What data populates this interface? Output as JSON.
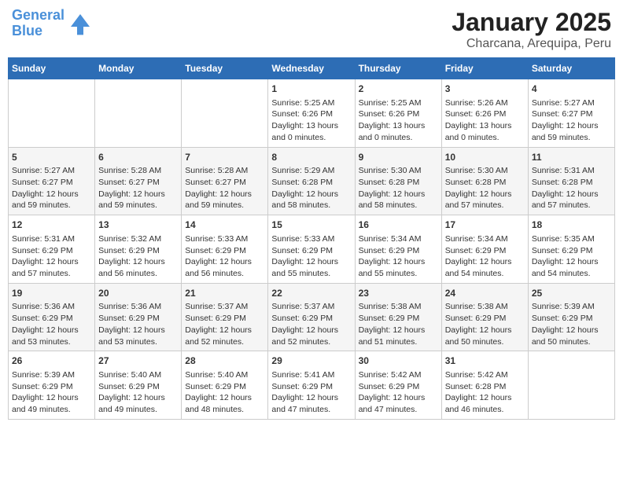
{
  "header": {
    "logo_line1": "General",
    "logo_line2": "Blue",
    "title": "January 2025",
    "subtitle": "Charcana, Arequipa, Peru"
  },
  "days_of_week": [
    "Sunday",
    "Monday",
    "Tuesday",
    "Wednesday",
    "Thursday",
    "Friday",
    "Saturday"
  ],
  "weeks": [
    [
      {
        "day": "",
        "info": ""
      },
      {
        "day": "",
        "info": ""
      },
      {
        "day": "",
        "info": ""
      },
      {
        "day": "1",
        "info": "Sunrise: 5:25 AM\nSunset: 6:26 PM\nDaylight: 13 hours\nand 0 minutes."
      },
      {
        "day": "2",
        "info": "Sunrise: 5:25 AM\nSunset: 6:26 PM\nDaylight: 13 hours\nand 0 minutes."
      },
      {
        "day": "3",
        "info": "Sunrise: 5:26 AM\nSunset: 6:26 PM\nDaylight: 13 hours\nand 0 minutes."
      },
      {
        "day": "4",
        "info": "Sunrise: 5:27 AM\nSunset: 6:27 PM\nDaylight: 12 hours\nand 59 minutes."
      }
    ],
    [
      {
        "day": "5",
        "info": "Sunrise: 5:27 AM\nSunset: 6:27 PM\nDaylight: 12 hours\nand 59 minutes."
      },
      {
        "day": "6",
        "info": "Sunrise: 5:28 AM\nSunset: 6:27 PM\nDaylight: 12 hours\nand 59 minutes."
      },
      {
        "day": "7",
        "info": "Sunrise: 5:28 AM\nSunset: 6:27 PM\nDaylight: 12 hours\nand 59 minutes."
      },
      {
        "day": "8",
        "info": "Sunrise: 5:29 AM\nSunset: 6:28 PM\nDaylight: 12 hours\nand 58 minutes."
      },
      {
        "day": "9",
        "info": "Sunrise: 5:30 AM\nSunset: 6:28 PM\nDaylight: 12 hours\nand 58 minutes."
      },
      {
        "day": "10",
        "info": "Sunrise: 5:30 AM\nSunset: 6:28 PM\nDaylight: 12 hours\nand 57 minutes."
      },
      {
        "day": "11",
        "info": "Sunrise: 5:31 AM\nSunset: 6:28 PM\nDaylight: 12 hours\nand 57 minutes."
      }
    ],
    [
      {
        "day": "12",
        "info": "Sunrise: 5:31 AM\nSunset: 6:29 PM\nDaylight: 12 hours\nand 57 minutes."
      },
      {
        "day": "13",
        "info": "Sunrise: 5:32 AM\nSunset: 6:29 PM\nDaylight: 12 hours\nand 56 minutes."
      },
      {
        "day": "14",
        "info": "Sunrise: 5:33 AM\nSunset: 6:29 PM\nDaylight: 12 hours\nand 56 minutes."
      },
      {
        "day": "15",
        "info": "Sunrise: 5:33 AM\nSunset: 6:29 PM\nDaylight: 12 hours\nand 55 minutes."
      },
      {
        "day": "16",
        "info": "Sunrise: 5:34 AM\nSunset: 6:29 PM\nDaylight: 12 hours\nand 55 minutes."
      },
      {
        "day": "17",
        "info": "Sunrise: 5:34 AM\nSunset: 6:29 PM\nDaylight: 12 hours\nand 54 minutes."
      },
      {
        "day": "18",
        "info": "Sunrise: 5:35 AM\nSunset: 6:29 PM\nDaylight: 12 hours\nand 54 minutes."
      }
    ],
    [
      {
        "day": "19",
        "info": "Sunrise: 5:36 AM\nSunset: 6:29 PM\nDaylight: 12 hours\nand 53 minutes."
      },
      {
        "day": "20",
        "info": "Sunrise: 5:36 AM\nSunset: 6:29 PM\nDaylight: 12 hours\nand 53 minutes."
      },
      {
        "day": "21",
        "info": "Sunrise: 5:37 AM\nSunset: 6:29 PM\nDaylight: 12 hours\nand 52 minutes."
      },
      {
        "day": "22",
        "info": "Sunrise: 5:37 AM\nSunset: 6:29 PM\nDaylight: 12 hours\nand 52 minutes."
      },
      {
        "day": "23",
        "info": "Sunrise: 5:38 AM\nSunset: 6:29 PM\nDaylight: 12 hours\nand 51 minutes."
      },
      {
        "day": "24",
        "info": "Sunrise: 5:38 AM\nSunset: 6:29 PM\nDaylight: 12 hours\nand 50 minutes."
      },
      {
        "day": "25",
        "info": "Sunrise: 5:39 AM\nSunset: 6:29 PM\nDaylight: 12 hours\nand 50 minutes."
      }
    ],
    [
      {
        "day": "26",
        "info": "Sunrise: 5:39 AM\nSunset: 6:29 PM\nDaylight: 12 hours\nand 49 minutes."
      },
      {
        "day": "27",
        "info": "Sunrise: 5:40 AM\nSunset: 6:29 PM\nDaylight: 12 hours\nand 49 minutes."
      },
      {
        "day": "28",
        "info": "Sunrise: 5:40 AM\nSunset: 6:29 PM\nDaylight: 12 hours\nand 48 minutes."
      },
      {
        "day": "29",
        "info": "Sunrise: 5:41 AM\nSunset: 6:29 PM\nDaylight: 12 hours\nand 47 minutes."
      },
      {
        "day": "30",
        "info": "Sunrise: 5:42 AM\nSunset: 6:29 PM\nDaylight: 12 hours\nand 47 minutes."
      },
      {
        "day": "31",
        "info": "Sunrise: 5:42 AM\nSunset: 6:28 PM\nDaylight: 12 hours\nand 46 minutes."
      },
      {
        "day": "",
        "info": ""
      }
    ]
  ]
}
